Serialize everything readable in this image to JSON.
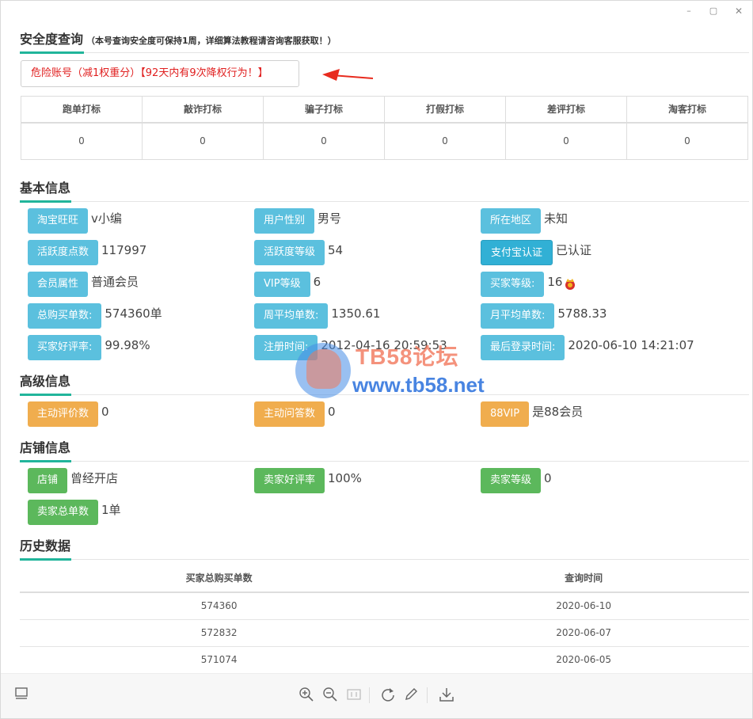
{
  "window": {
    "minimize": "–",
    "maximize": "▢",
    "close": "✕"
  },
  "security": {
    "title": "安全度查询",
    "note": "（本号查询安全度可保持1周，详细算法教程请咨询客服获取！）",
    "warning": "危险账号（减1权重分）【92天内有9次降权行为！】",
    "columns": [
      "跑单打标",
      "敲诈打标",
      "骗子打标",
      "打假打标",
      "差评打标",
      "淘客打标"
    ],
    "values": [
      "0",
      "0",
      "0",
      "0",
      "0",
      "0"
    ]
  },
  "basic": {
    "title": "基本信息",
    "items": [
      {
        "label": "淘宝旺旺",
        "value": "v小编"
      },
      {
        "label": "用户性别",
        "value": "男号"
      },
      {
        "label": "所在地区",
        "value": "未知"
      },
      {
        "label": "活跃度点数",
        "value": "117997"
      },
      {
        "label": "活跃度等级",
        "value": "54"
      },
      {
        "label": "支付宝认证",
        "value": "已认证"
      },
      {
        "label": "会员属性",
        "value": "普通会员"
      },
      {
        "label": "VIP等级",
        "value": "6"
      },
      {
        "label": "买家等级:",
        "value": "16"
      },
      {
        "label": "总购买单数:",
        "value": "574360单"
      },
      {
        "label": "周平均单数:",
        "value": "1350.61"
      },
      {
        "label": "月平均单数:",
        "value": "5788.33"
      },
      {
        "label": "买家好评率:",
        "value": "99.98%"
      },
      {
        "label": "注册时间:",
        "value": "2012-04-16 20:59:53"
      },
      {
        "label": "最后登录时间:",
        "value": "2020-06-10 14:21:07"
      }
    ]
  },
  "advanced": {
    "title": "高级信息",
    "items": [
      {
        "label": "主动评价数",
        "value": "0"
      },
      {
        "label": "主动问答数",
        "value": "0"
      },
      {
        "label": "88VIP",
        "value": "是88会员"
      }
    ]
  },
  "shop": {
    "title": "店铺信息",
    "items": [
      {
        "label": "店铺",
        "value": "曾经开店"
      },
      {
        "label": "卖家好评率",
        "value": "100%"
      },
      {
        "label": "卖家等级",
        "value": "0"
      },
      {
        "label": "卖家总单数",
        "value": "1单"
      }
    ]
  },
  "history": {
    "title": "历史数据",
    "columns": [
      "买家总购买单数",
      "查询时间"
    ],
    "rows": [
      [
        "574360",
        "2020-06-10"
      ],
      [
        "572832",
        "2020-06-07"
      ],
      [
        "571074",
        "2020-06-05"
      ]
    ]
  },
  "watermark": {
    "line1": "TB58论坛",
    "line2": "www.tb58.net"
  },
  "colors": {
    "accent": "#21b59b",
    "info": "#5bc0de",
    "warning": "#f0ad4e",
    "success": "#5cb85c",
    "danger": "#e02020"
  },
  "toolbar_icons": [
    "thumbnail-icon",
    "zoom-in-icon",
    "zoom-out-icon",
    "actual-size-icon",
    "rotate-icon",
    "edit-icon",
    "download-icon"
  ]
}
